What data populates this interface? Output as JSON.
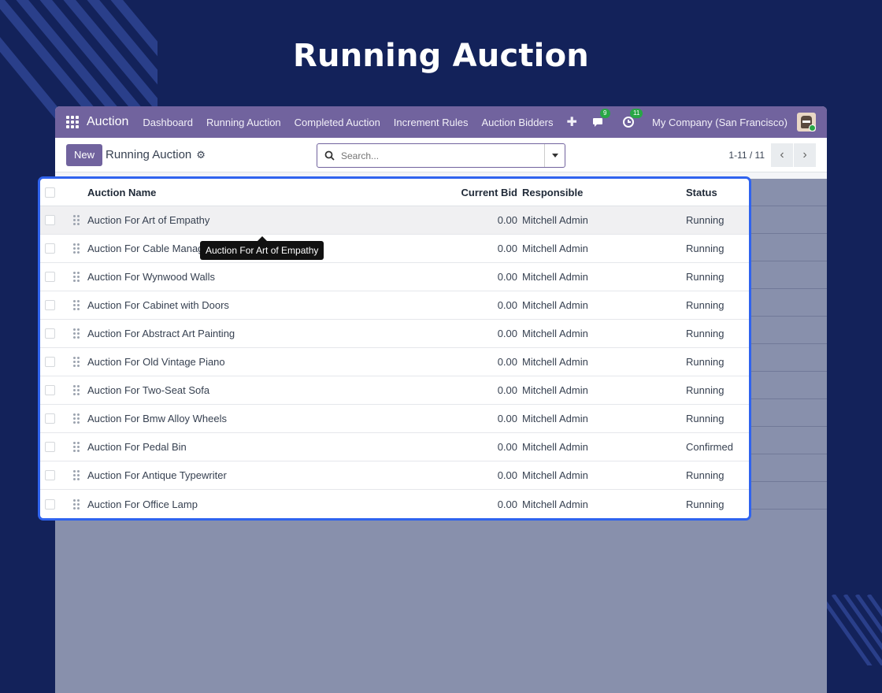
{
  "hero": {
    "title": "Running Auction"
  },
  "navbar": {
    "brand": "Auction",
    "items": [
      "Dashboard",
      "Running Auction",
      "Completed Auction",
      "Increment Rules",
      "Auction Bidders"
    ],
    "plus": "✚",
    "messages_count": "9",
    "activities_count": "11",
    "company": "My Company (San Francisco)"
  },
  "control": {
    "new_label": "New",
    "breadcrumb": "Running Auction",
    "gear": "⚙",
    "search_placeholder": "Search...",
    "pager": "1-11 / 11",
    "prev": "‹",
    "next": "›"
  },
  "table": {
    "headers": [
      "Auction Name",
      "Current Bid",
      "Responsible",
      "Status"
    ],
    "rows": [
      {
        "name": "Auction For Art of Empathy",
        "bid": "0.00",
        "responsible": "Mitchell Admin",
        "status": "Running"
      },
      {
        "name": "Auction For Cable Management",
        "bid": "0.00",
        "responsible": "Mitchell Admin",
        "status": "Running"
      },
      {
        "name": "Auction For Wynwood Walls",
        "bid": "0.00",
        "responsible": "Mitchell Admin",
        "status": "Running"
      },
      {
        "name": "Auction For Cabinet with Doors",
        "bid": "0.00",
        "responsible": "Mitchell Admin",
        "status": "Running"
      },
      {
        "name": "Auction For Abstract Art Painting",
        "bid": "0.00",
        "responsible": "Mitchell Admin",
        "status": "Running"
      },
      {
        "name": "Auction For Old Vintage Piano",
        "bid": "0.00",
        "responsible": "Mitchell Admin",
        "status": "Running"
      },
      {
        "name": "Auction For Two-Seat Sofa",
        "bid": "0.00",
        "responsible": "Mitchell Admin",
        "status": "Running"
      },
      {
        "name": "Auction For Bmw Alloy Wheels",
        "bid": "0.00",
        "responsible": "Mitchell Admin",
        "status": "Running"
      },
      {
        "name": "Auction For Pedal Bin",
        "bid": "0.00",
        "responsible": "Mitchell Admin",
        "status": "Confirmed"
      },
      {
        "name": "Auction For Antique Typewriter",
        "bid": "0.00",
        "responsible": "Mitchell Admin",
        "status": "Running"
      },
      {
        "name": "Auction For Office Lamp",
        "bid": "0.00",
        "responsible": "Mitchell Admin",
        "status": "Running"
      }
    ]
  },
  "tooltip": {
    "text": "Auction For Art of Empathy"
  },
  "colors": {
    "background": "#13225a",
    "navbar": "#71639e",
    "highlight_border": "#2f63ee"
  }
}
